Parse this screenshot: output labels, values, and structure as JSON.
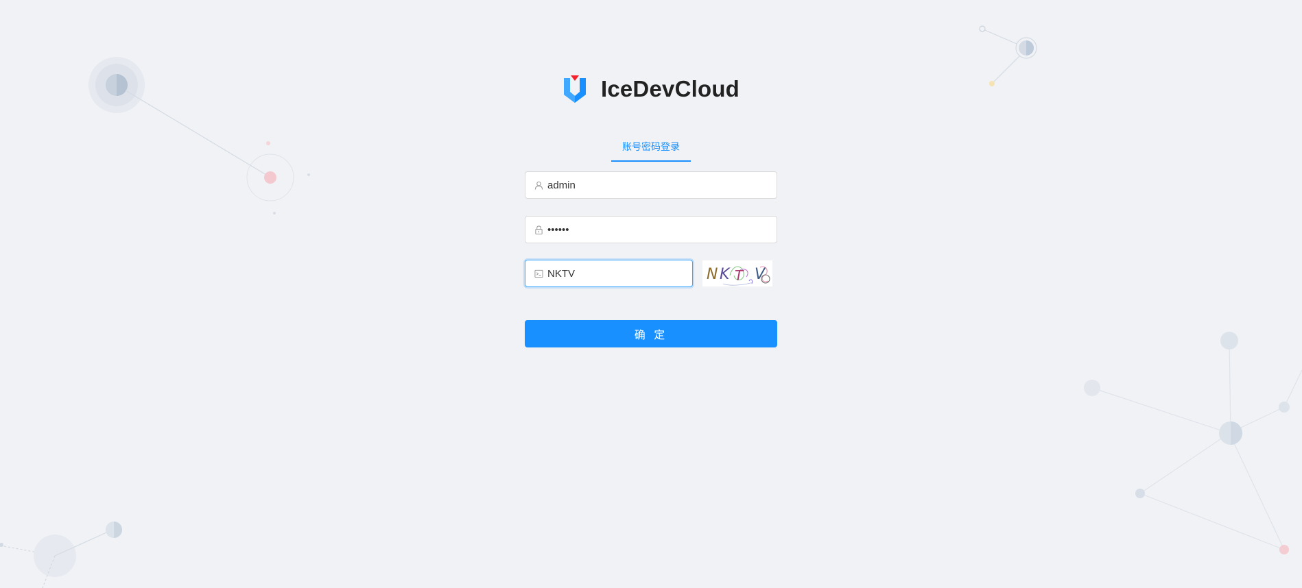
{
  "brand": {
    "name": "IceDevCloud"
  },
  "tabs": [
    {
      "label": "账号密码登录",
      "active": true
    }
  ],
  "form": {
    "username": {
      "value": "admin",
      "icon": "user-icon"
    },
    "password": {
      "value": "••••••",
      "icon": "lock-icon"
    },
    "captcha": {
      "value": "NKTV",
      "icon": "code-icon"
    },
    "captcha_image_text": "NKTV",
    "submit_label": "确 定"
  },
  "colors": {
    "primary": "#1890ff",
    "background": "#f0f2f5",
    "logo_blue": "#1890ff",
    "logo_red": "#f5222d"
  }
}
